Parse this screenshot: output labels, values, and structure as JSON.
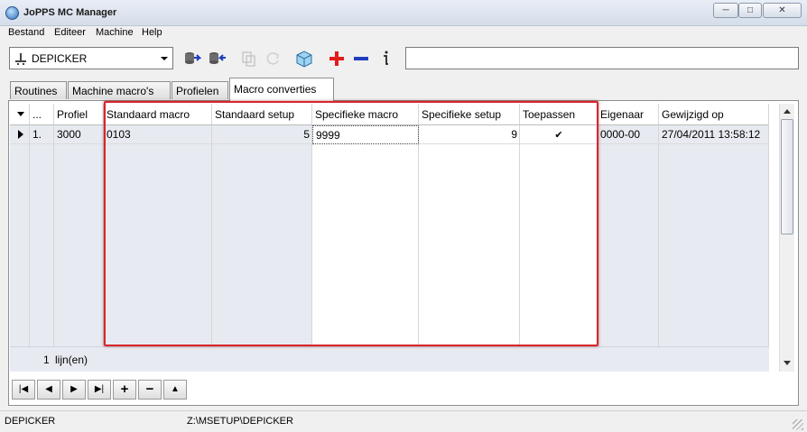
{
  "window": {
    "title": "JoPPS MC Manager",
    "min": "─",
    "max": "□",
    "close": "✕"
  },
  "menu": [
    "Bestand",
    "Editeer",
    "Machine",
    "Help"
  ],
  "machine_select": {
    "value": "DEPICKER"
  },
  "toolbar": {
    "icons": [
      "import-icon",
      "export-icon",
      "copy-icon",
      "refresh-icon",
      "package-icon",
      "add-icon",
      "remove-icon",
      "info-icon"
    ],
    "search_value": ""
  },
  "tabs": [
    "Routines",
    "Machine macro's",
    "Profielen",
    "Macro converties"
  ],
  "active_tab": 3,
  "grid": {
    "headers": [
      "...",
      "Profiel",
      "Standaard macro",
      "Standaard setup",
      "Specifieke macro",
      "Specifieke setup",
      "Toepassen",
      "Eigenaar",
      "Gewijzigd op"
    ],
    "rows": [
      {
        "nr": "1.",
        "profiel": "3000",
        "standaard_macro": "0103",
        "standaard_setup": "5",
        "specifieke_macro": "9999",
        "specifieke_setup": "9",
        "toepassen": true,
        "toepassen_mark": "✔",
        "eigenaar": "0000-00",
        "gewijzigd_op": "27/04/2011 13:58:12"
      }
    ],
    "footer": {
      "count": "1",
      "label": "lijn(en)"
    }
  },
  "nav_buttons": [
    "|◀",
    "◀",
    "▶",
    "▶|",
    "+",
    "−",
    "▲"
  ],
  "status": {
    "machine": "DEPICKER",
    "path": "Z:\\MSETUP\\DEPICKER"
  },
  "colors": {
    "highlight": "#d7262b",
    "accent_red": "#e21b1b",
    "accent_blue": "#1f3fbf"
  }
}
